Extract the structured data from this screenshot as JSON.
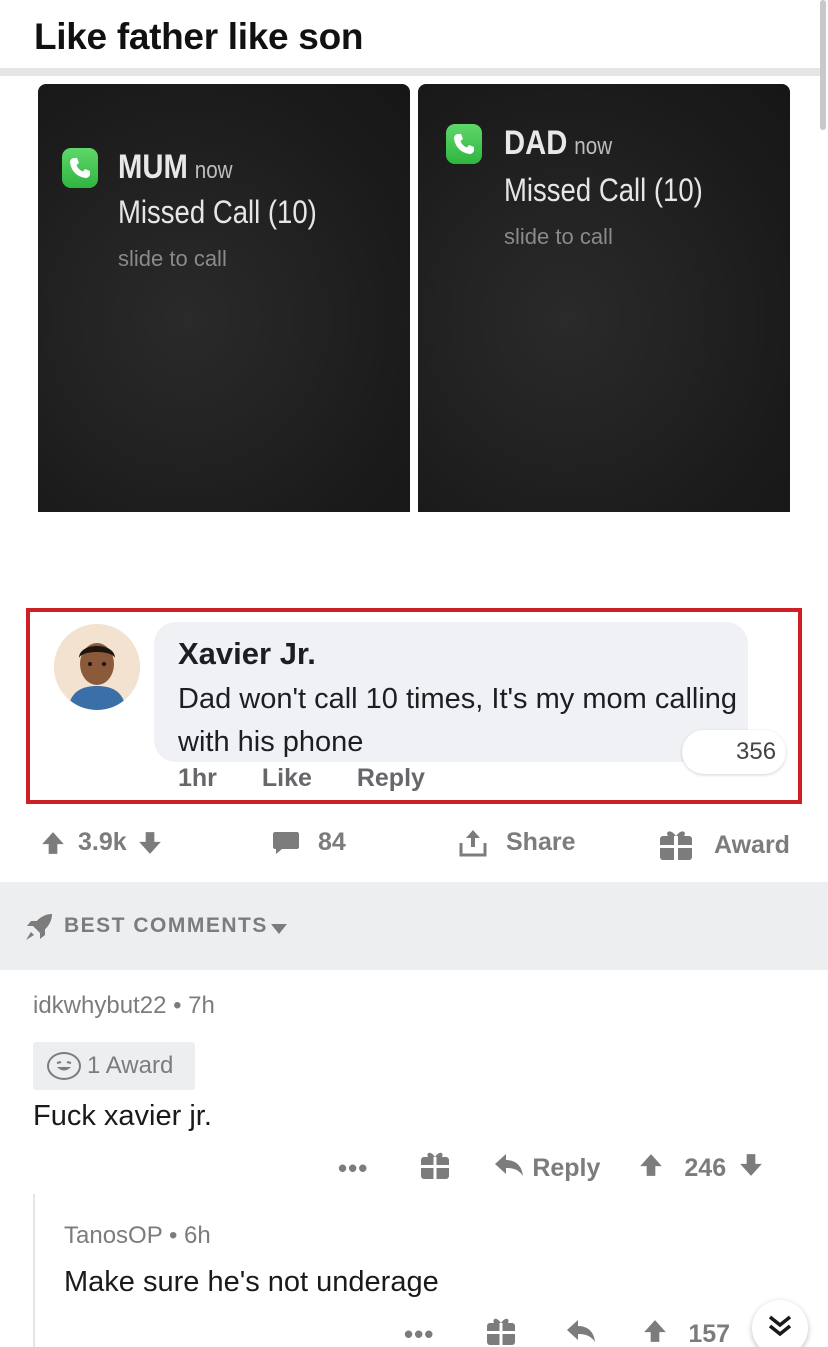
{
  "post": {
    "title": "Like father like son"
  },
  "meme": {
    "left_phone": {
      "caller": "MUM",
      "time": "now",
      "missed": "Missed Call (10)",
      "slide": "slide to call"
    },
    "right_phone": {
      "caller": "DAD",
      "time": "now",
      "missed": "Missed Call (10)",
      "slide": "slide to call"
    },
    "fb_comment": {
      "name": "Xavier Jr.",
      "text": "Dad won't call 10 times, It's my mom calling with his phone",
      "count": "356",
      "time": "1hr",
      "like": "Like",
      "reply": "Reply"
    }
  },
  "actions": {
    "upvotes": "3.9k",
    "comments": "84",
    "share": "Share",
    "award": "Award"
  },
  "section": {
    "label": "BEST COMMENTS"
  },
  "comments": [
    {
      "author": "idkwhybut22",
      "age": "7h",
      "award": "1 Award",
      "body": "Fuck xavier jr.",
      "reply": "Reply",
      "score": "246"
    },
    {
      "author": "TanosOP",
      "age": "6h",
      "body": "Make sure he's not underage",
      "score": "157"
    }
  ],
  "colors": {
    "highlight_border": "#cf1f26",
    "call_green": "#2fb541",
    "muted_text": "#7c7c7c",
    "section_bg": "#edeef0"
  },
  "icons": [
    "phone-icon",
    "upvote-icon",
    "downvote-icon",
    "comment-icon",
    "share-icon",
    "gift-icon",
    "rocket-icon",
    "caret-down-icon",
    "more-icon",
    "reply-icon",
    "double-chevron-down-icon"
  ]
}
